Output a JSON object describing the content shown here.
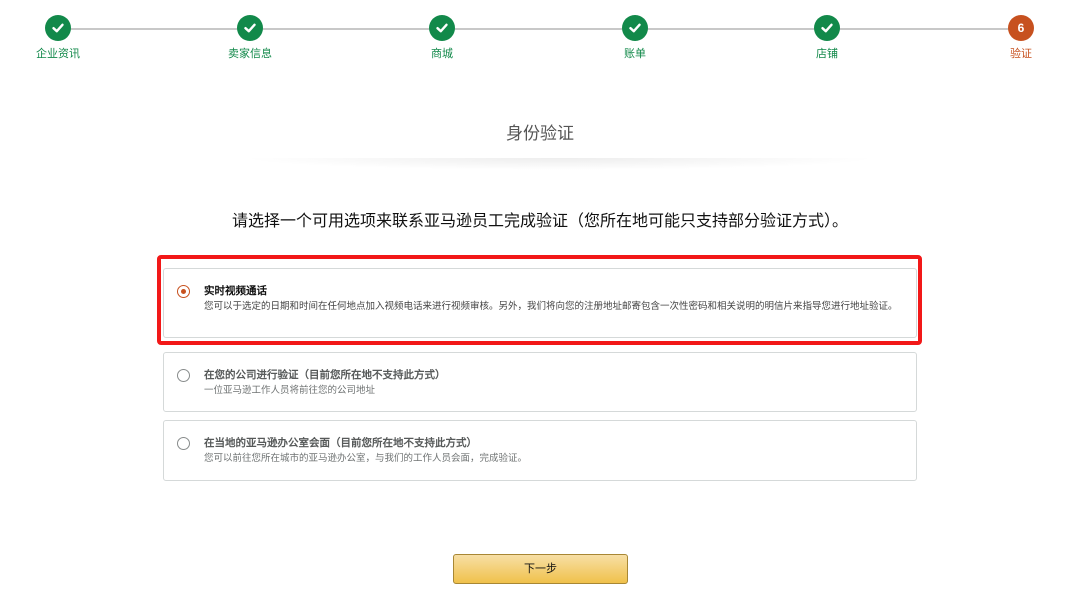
{
  "stepper": {
    "steps": [
      {
        "label": "企业资讯",
        "state": "done",
        "marker": "check-icon"
      },
      {
        "label": "卖家信息",
        "state": "done",
        "marker": "check-icon"
      },
      {
        "label": "商城",
        "state": "done",
        "marker": "check-icon"
      },
      {
        "label": "账单",
        "state": "done",
        "marker": "check-icon"
      },
      {
        "label": "店铺",
        "state": "done",
        "marker": "check-icon"
      },
      {
        "label": "验证",
        "state": "current",
        "number": "6"
      }
    ],
    "colors": {
      "done": "#12894a",
      "current": "#c7511f"
    }
  },
  "page": {
    "title": "身份验证",
    "instruction": "请选择一个可用选项来联系亚马逊员工完成验证（您所在地可能只支持部分验证方式）。"
  },
  "options": [
    {
      "title": "实时视频通话",
      "description": "您可以于选定的日期和时间在任何地点加入视频电话来进行视频审核。另外，我们将向您的注册地址邮寄包含一次性密码和相关说明的明信片来指导您进行地址验证。",
      "selected": true,
      "enabled": true
    },
    {
      "title": "在您的公司进行验证（目前您所在地不支持此方式）",
      "description": "一位亚马逊工作人员将前往您的公司地址",
      "selected": false,
      "enabled": false
    },
    {
      "title": "在当地的亚马逊办公室会面（目前您所在地不支持此方式）",
      "description": "您可以前往您所在城市的亚马逊办公室，与我们的工作人员会面，完成验证。",
      "selected": false,
      "enabled": false
    }
  ],
  "actions": {
    "next_label": "下一步"
  },
  "annotation": {
    "highlight_color": "#f21818"
  }
}
